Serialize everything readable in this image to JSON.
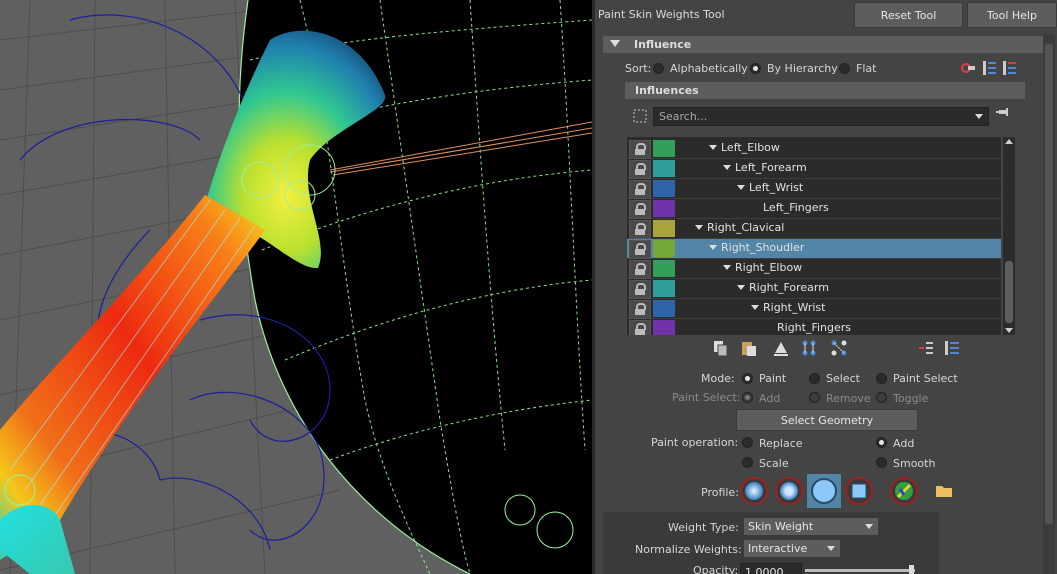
{
  "panel": {
    "title": "Paint Skin Weights Tool",
    "reset_label": "Reset Tool",
    "help_label": "Tool Help"
  },
  "influence": {
    "section_label": "Influence",
    "sort_label": "Sort:",
    "sort_options": [
      "Alphabetically",
      "By Hierarchy",
      "Flat"
    ],
    "sort_selected": "By Hierarchy",
    "influences_label": "Influences",
    "search_placeholder": "Search...",
    "joints": [
      {
        "name": "Left_Elbow",
        "color": "#32a05a",
        "depth": 3,
        "selected": false
      },
      {
        "name": "Left_Forearm",
        "color": "#2e9f9a",
        "depth": 4,
        "selected": false
      },
      {
        "name": "Left_Wrist",
        "color": "#2f64a8",
        "depth": 5,
        "selected": false
      },
      {
        "name": "Left_Fingers",
        "color": "#7232a8",
        "depth": 6,
        "selected": false
      },
      {
        "name": "Right_Clavical",
        "color": "#a8a33a",
        "depth": 2,
        "selected": false
      },
      {
        "name": "Right_Shoudler",
        "color": "#74a83a",
        "depth": 3,
        "selected": true
      },
      {
        "name": "Right_Elbow",
        "color": "#32a05a",
        "depth": 4,
        "selected": false
      },
      {
        "name": "Right_Forearm",
        "color": "#2e9f9a",
        "depth": 5,
        "selected": false
      },
      {
        "name": "Right_Wrist",
        "color": "#2f64a8",
        "depth": 6,
        "selected": false
      },
      {
        "name": "Right_Fingers",
        "color": "#7232a8",
        "depth": 7,
        "selected": false
      }
    ]
  },
  "mode": {
    "label": "Mode:",
    "options": [
      "Paint",
      "Select",
      "Paint Select"
    ],
    "selected": "Paint"
  },
  "paint_select": {
    "label": "Paint Select:",
    "options": [
      "Add",
      "Remove",
      "Toggle"
    ]
  },
  "select_geometry_label": "Select Geometry",
  "paint_operation": {
    "label": "Paint operation:",
    "options": [
      "Replace",
      "Add",
      "Scale",
      "Smooth"
    ],
    "selected": "Add"
  },
  "profile": {
    "label": "Profile:",
    "icons": [
      "gaussian-brush-icon",
      "soft-brush-icon",
      "solid-brush-icon",
      "square-brush-icon",
      "texture-brush-icon",
      "folder-icon"
    ]
  },
  "weight_type": {
    "label": "Weight Type:",
    "value": "Skin Weight"
  },
  "normalize": {
    "label": "Normalize Weights:",
    "value": "Interactive"
  },
  "opacity": {
    "label": "Opacity:",
    "value": "1.0000"
  }
}
